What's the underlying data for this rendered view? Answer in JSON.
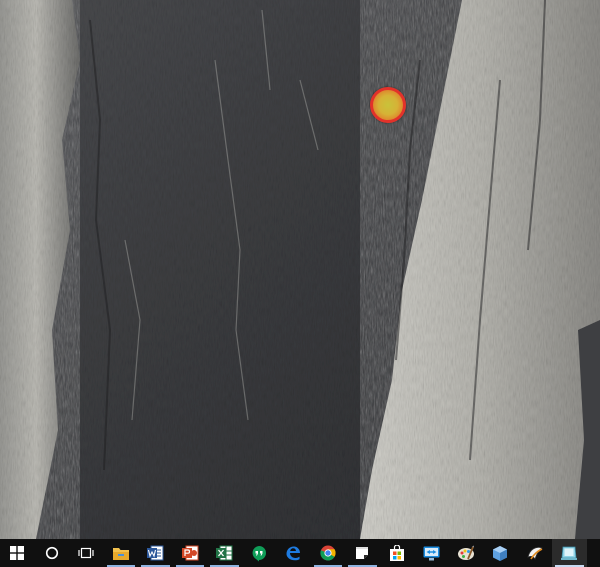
{
  "desktop": {
    "wallpaper": "granite-cliff-wallpaper"
  },
  "cursor": {
    "icon": "click-highlight-circle",
    "ring_color": "#e2322a",
    "fill_color": "#d6b236"
  },
  "taskbar": {
    "background": "#101010",
    "indicator_color": "#8fb3e0",
    "items": [
      {
        "icon": "windows-start-icon",
        "running": false
      },
      {
        "icon": "cortana-search-icon",
        "running": false
      },
      {
        "icon": "task-view-icon",
        "running": false
      },
      {
        "icon": "file-explorer-icon",
        "running": true
      },
      {
        "icon": "word-icon",
        "running": true
      },
      {
        "icon": "powerpoint-icon",
        "running": true
      },
      {
        "icon": "excel-icon",
        "running": true
      },
      {
        "icon": "hangouts-icon",
        "running": false
      },
      {
        "icon": "edge-icon",
        "running": false
      },
      {
        "icon": "chrome-icon",
        "running": true
      },
      {
        "icon": "sticky-notes-icon",
        "running": true
      },
      {
        "icon": "store-icon",
        "running": false
      },
      {
        "icon": "teamviewer-icon",
        "running": false
      },
      {
        "icon": "paint-icon",
        "running": false
      },
      {
        "icon": "virtualbox-icon",
        "running": false
      },
      {
        "icon": "inkscape-icon",
        "running": false
      },
      {
        "icon": "tablet-app-icon",
        "running": true
      }
    ]
  }
}
